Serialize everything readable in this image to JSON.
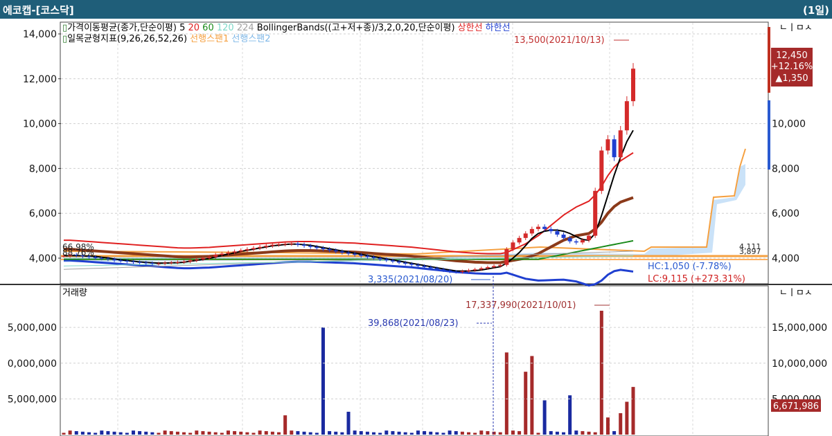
{
  "window": {
    "title": "에코캡-[코스닥]",
    "period": "(1일)"
  },
  "top_panel": {
    "legend_line1": [
      {
        "text": "가격이동평균(종가,단순이평)",
        "color": "#000000"
      },
      {
        "text": "5",
        "color": "#000000"
      },
      {
        "text": "20",
        "color": "#e02020"
      },
      {
        "text": "60",
        "color": "#1a8a1a"
      },
      {
        "text": "120",
        "color": "#7fd8c8"
      },
      {
        "text": "224",
        "color": "#a0a0a0"
      },
      {
        "text": "BollingerBands((고+저+종)/3,2,0,20,단순이평)",
        "color": "#000000"
      },
      {
        "text": "상한선",
        "color": "#e02020"
      },
      {
        "text": "하한선",
        "color": "#1f3fd0"
      }
    ],
    "legend_line2": [
      {
        "text": "일목균형지표(9,26,26,52,26)",
        "color": "#000000"
      },
      {
        "text": "선행스팬1",
        "color": "#f5a040"
      },
      {
        "text": "선행스팬2",
        "color": "#7fb8e8"
      }
    ],
    "max_annotation": "13,500(2021/10/13)",
    "min_annotation": "3,335(2021/08/20)",
    "hc_text": "HC:1,050 (-7.78%)",
    "lc_text": "LC:9,115 (+273.31%)",
    "left_overlay_labels": [
      "66.98%",
      "88.76%"
    ],
    "right_small_labels": [
      "4,111",
      "3,897"
    ],
    "price_badge": {
      "price": "12,450",
      "change": "+12.16%",
      "diff": "▲1,350"
    },
    "left_ticks": [
      "14,000",
      "12,000",
      "10,000",
      "8,000",
      "6,000",
      "4,000"
    ],
    "right_ticks": [
      "10,000",
      "8,000",
      "6,000",
      "4,000"
    ],
    "window_buttons": "ㄴㅣㅁㅅ"
  },
  "bottom_panel": {
    "legend": "거래량",
    "max_annotation": "17,337,990(2021/10/01)",
    "min_annotation": "39,868(2021/08/23)",
    "left_ticks": [
      "5,000,000",
      "0,000,000",
      "5,000,000"
    ],
    "right_ticks": [
      "15,000,000",
      "10,000,000",
      "5,000,000"
    ],
    "current_badge": "6,671,986",
    "window_buttons": "ㄴㅣㅁㅅ"
  },
  "colors": {
    "up": "#d42a2a",
    "down": "#1f3fd0",
    "volume_up": "#a52a2a",
    "volume_down": "#1a2aa0",
    "span1": "#f5a040",
    "span2": "#b8d8f5",
    "titlebar": "#1f5e79"
  },
  "chart_data": {
    "type": "line",
    "x_axis": "daily",
    "price_ylim": [
      3000,
      14500
    ],
    "volume_ylim": [
      0,
      18500000
    ],
    "close": [
      4100,
      4150,
      4120,
      4080,
      4050,
      4000,
      3980,
      3950,
      3900,
      3880,
      3850,
      3820,
      3800,
      3780,
      3750,
      3760,
      3790,
      3800,
      3820,
      3850,
      3900,
      3950,
      4000,
      4050,
      4150,
      4200,
      4250,
      4300,
      4350,
      4400,
      4450,
      4500,
      4550,
      4600,
      4620,
      4640,
      4650,
      4600,
      4550,
      4500,
      4450,
      4400,
      4350,
      4300,
      4250,
      4200,
      4150,
      4100,
      4050,
      4000,
      3950,
      3900,
      3850,
      3800,
      3750,
      3700,
      3650,
      3600,
      3550,
      3500,
      3450,
      3400,
      3380,
      3420,
      3460,
      3500,
      3550,
      3600,
      3650,
      3700,
      4400,
      4700,
      4900,
      5100,
      5300,
      5400,
      5300,
      5200,
      5050,
      4900,
      4750,
      4700,
      4800,
      5000,
      7000,
      8800,
      9300,
      8500,
      9700,
      11000,
      12450
    ],
    "ma5": [
      4100,
      4110,
      4115,
      4100,
      4090,
      4080,
      4040,
      4010,
      3960,
      3920,
      3890,
      3860,
      3830,
      3810,
      3790,
      3780,
      3780,
      3790,
      3800,
      3820,
      3860,
      3900,
      3940,
      3990,
      4050,
      4120,
      4180,
      4240,
      4300,
      4350,
      4400,
      4450,
      4500,
      4550,
      4580,
      4610,
      4630,
      4620,
      4600,
      4570,
      4520,
      4470,
      4420,
      4370,
      4320,
      4270,
      4220,
      4170,
      4120,
      4070,
      4020,
      3970,
      3920,
      3870,
      3820,
      3770,
      3720,
      3670,
      3620,
      3570,
      3520,
      3470,
      3430,
      3420,
      3430,
      3440,
      3470,
      3520,
      3570,
      3620,
      3780,
      4000,
      4250,
      4560,
      4880,
      5100,
      5200,
      5250,
      5250,
      5200,
      5100,
      4960,
      4830,
      4800,
      5100,
      5900,
      6800,
      7700,
      8500,
      9200,
      9700
    ],
    "ma20": [
      4400,
      4400,
      4380,
      4360,
      4340,
      4320,
      4300,
      4280,
      4260,
      4240,
      4220,
      4200,
      4180,
      4160,
      4140,
      4120,
      4100,
      4080,
      4060,
      4050,
      4050,
      4060,
      4070,
      4080,
      4100,
      4120,
      4140,
      4160,
      4180,
      4200,
      4220,
      4240,
      4260,
      4280,
      4300,
      4320,
      4330,
      4340,
      4340,
      4340,
      4330,
      4320,
      4310,
      4300,
      4290,
      4280,
      4270,
      4250,
      4230,
      4210,
      4190,
      4170,
      4150,
      4130,
      4110,
      4090,
      4060,
      4030,
      4000,
      3970,
      3940,
      3910,
      3880,
      3860,
      3840,
      3820,
      3810,
      3800,
      3800,
      3800,
      3850,
      3900,
      3950,
      4000,
      4100,
      4200,
      4350,
      4500,
      4650,
      4800,
      4900,
      5000,
      5050,
      5100,
      5300,
      5600,
      6000,
      6300,
      6500,
      6600,
      6700
    ]
  }
}
